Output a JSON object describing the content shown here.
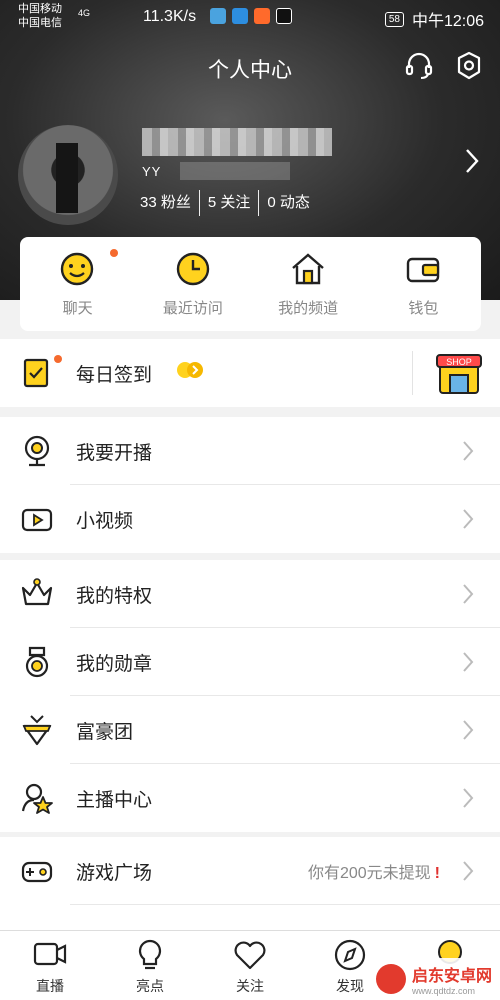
{
  "status_bar": {
    "carrier1": "中国移动",
    "carrier2": "中国电信",
    "network": "4G",
    "speed": "11.3K/s",
    "battery": "58",
    "time": "中午12:06"
  },
  "header": {
    "title": "个人中心",
    "icons": [
      "headset-icon",
      "settings-icon"
    ]
  },
  "profile": {
    "id_prefix": "YY",
    "stats": [
      "33 粉丝",
      "5 关注",
      "0 动态"
    ]
  },
  "quick_actions": [
    {
      "label": "聊天",
      "icon": "chat-icon",
      "badge": true
    },
    {
      "label": "最近访问",
      "icon": "clock-icon",
      "badge": false
    },
    {
      "label": "我的频道",
      "icon": "home-icon",
      "badge": false
    },
    {
      "label": "钱包",
      "icon": "wallet-icon",
      "badge": false
    }
  ],
  "checkin": {
    "label": "每日签到",
    "shop_label": "SHOP"
  },
  "menu_group1": [
    {
      "label": "我要开播",
      "icon": "webcam-icon"
    },
    {
      "label": "小视频",
      "icon": "video-icon"
    }
  ],
  "menu_group2": [
    {
      "label": "我的特权",
      "icon": "crown-icon"
    },
    {
      "label": "我的勋章",
      "icon": "medal-icon"
    },
    {
      "label": "富豪团",
      "icon": "gem-icon"
    },
    {
      "label": "主播中心",
      "icon": "star-person-icon"
    }
  ],
  "menu_group3": [
    {
      "label": "游戏广场",
      "icon": "gamepad-icon",
      "note": "你有200元未提现"
    }
  ],
  "bottom_nav": [
    {
      "label": "直播",
      "icon": "live-icon"
    },
    {
      "label": "亮点",
      "icon": "bulb-icon"
    },
    {
      "label": "关注",
      "icon": "heart-icon"
    },
    {
      "label": "发现",
      "icon": "compass-icon"
    }
  ],
  "watermark": {
    "title": "启东安卓网",
    "url": "www.qdtdz.com"
  },
  "colors": {
    "accent": "#ffd21e",
    "badge": "#f56a2e",
    "alert": "#e0312f"
  }
}
